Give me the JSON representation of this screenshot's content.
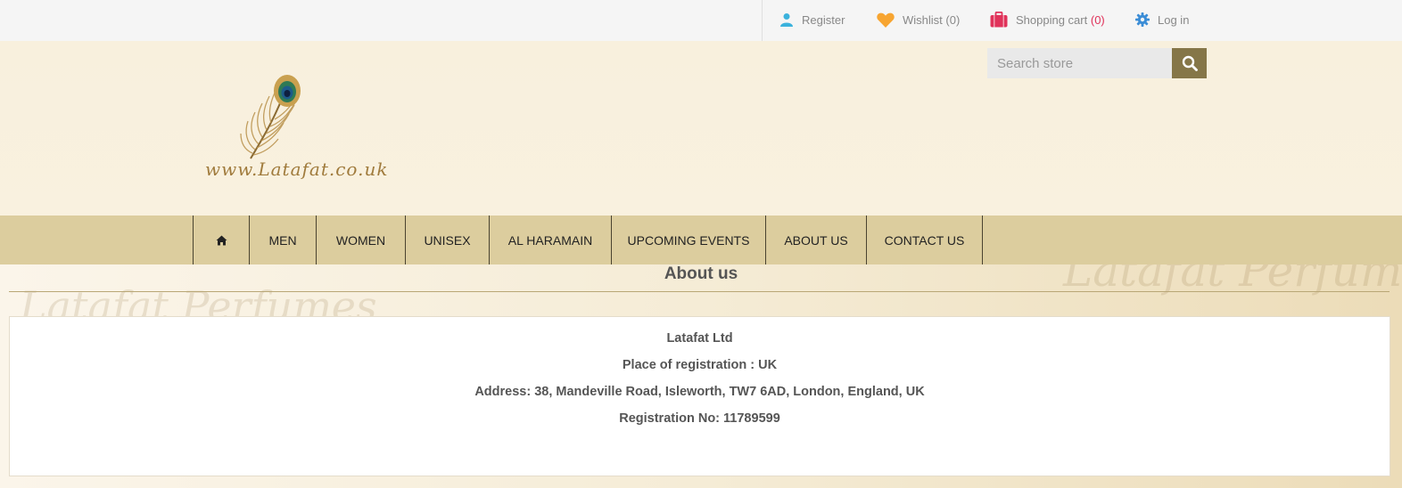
{
  "header_links": {
    "register": "Register",
    "wishlist_label": "Wishlist",
    "wishlist_count": "(0)",
    "cart_label": "Shopping cart",
    "cart_count": "(0)",
    "login": "Log in"
  },
  "logo": {
    "text": "www.Latafat.co.uk"
  },
  "search": {
    "placeholder": "Search store"
  },
  "menu": {
    "items": [
      "MEN",
      "WOMEN",
      "UNISEX",
      "AL HARAMAIN",
      "UPCOMING EVENTS",
      "ABOUT US",
      "CONTACT US"
    ]
  },
  "watermark": {
    "text_left": "Latafat Perfumes",
    "text_right": "Latafat Perfumes"
  },
  "page": {
    "title": "About us"
  },
  "info": {
    "company": "Latafat Ltd",
    "registration_place": "Place of registration : UK",
    "address": "Address: 38, Mandeville Road, Isleworth, TW7 6AD, London, England, UK",
    "registration_no": "Registration No: 11789599"
  },
  "colors": {
    "accent_button": "#857648",
    "menu_bg": "#dccd9e",
    "count_pink": "#e0325a",
    "register_icon": "#3bb2dc",
    "wishlist_icon": "#f7a531",
    "cart_icon": "#e0325a",
    "login_icon": "#3b8dd6"
  }
}
